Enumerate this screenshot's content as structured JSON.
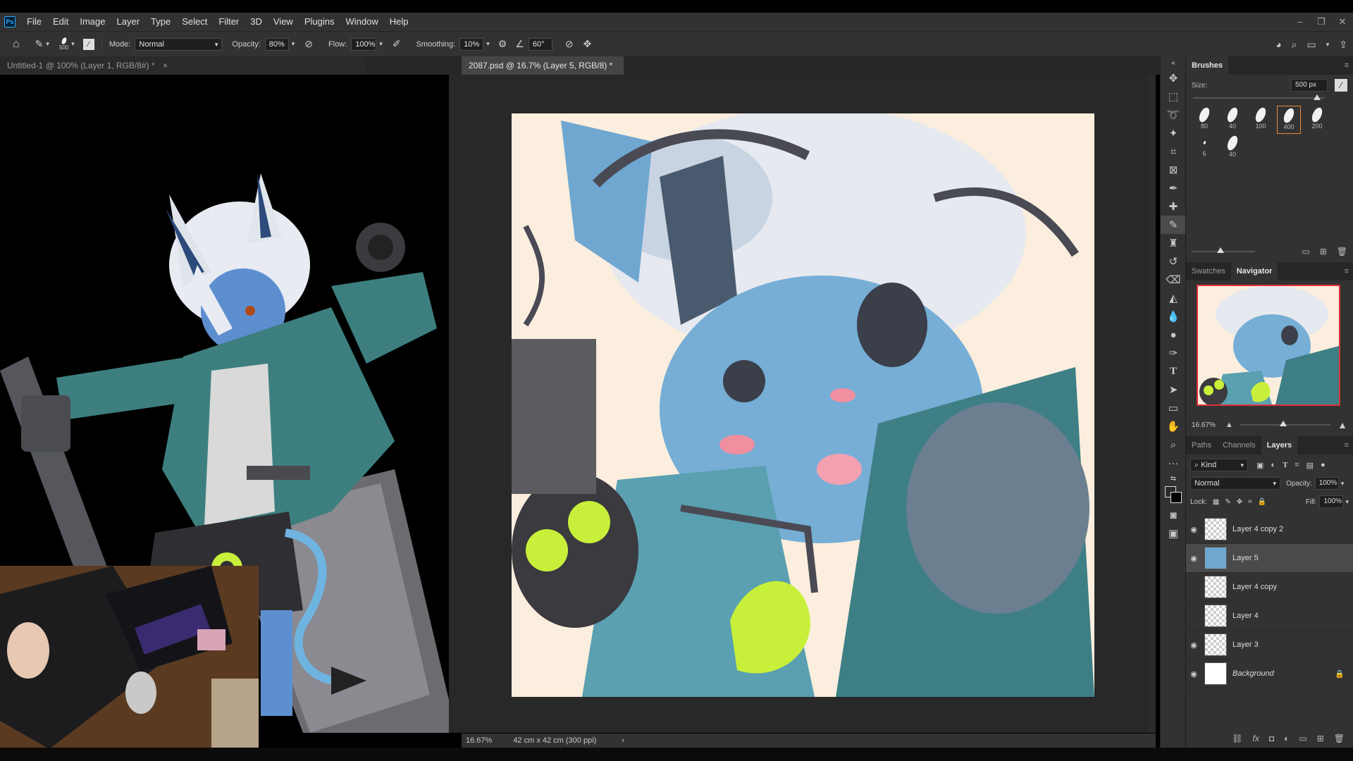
{
  "menu": {
    "logo": "Ps",
    "items": [
      "File",
      "Edit",
      "Image",
      "Layer",
      "Type",
      "Select",
      "Filter",
      "3D",
      "View",
      "Plugins",
      "Window",
      "Help"
    ]
  },
  "options": {
    "brush_size": "500",
    "mode_label": "Mode:",
    "mode_value": "Normal",
    "opacity_label": "Opacity:",
    "opacity_value": "80%",
    "flow_label": "Flow:",
    "flow_value": "100%",
    "smoothing_label": "Smoothing:",
    "smoothing_value": "10%",
    "angle_value": "60°"
  },
  "tabs": {
    "left": "Untitled-1 @ 100% (Layer 1, RGB/8#) *",
    "right": "2087.psd @ 16.7% (Layer 5, RGB/8) *"
  },
  "status": {
    "zoom": "16.67%",
    "doc_info": "42 cm x 42 cm (300 ppi)"
  },
  "brushes_panel": {
    "title": "Brushes",
    "size_label": "Size:",
    "size_value": "500 px",
    "tips": [
      "80",
      "40",
      "100",
      "400",
      "200",
      "6",
      "40"
    ],
    "selected_tip": "400"
  },
  "navigator_panel": {
    "tabs": [
      "Swatches",
      "Navigator"
    ],
    "zoom": "16.67%"
  },
  "layers_panel": {
    "tabs": [
      "Paths",
      "Channels",
      "Layers"
    ],
    "filter_kind": "Kind",
    "blend_mode": "Normal",
    "opacity_label": "Opacity:",
    "opacity_value": "100%",
    "lock_label": "Lock:",
    "fill_label": "Fill:",
    "fill_value": "100%",
    "layers": [
      {
        "name": "Layer 4 copy 2",
        "visible": true,
        "selected": false
      },
      {
        "name": "Layer 5",
        "visible": true,
        "selected": true
      },
      {
        "name": "Layer 4 copy",
        "visible": false,
        "selected": false
      },
      {
        "name": "Layer 4",
        "visible": false,
        "selected": false
      },
      {
        "name": "Layer 3",
        "visible": true,
        "selected": false
      },
      {
        "name": "Background",
        "visible": true,
        "selected": false
      }
    ]
  },
  "colors": {
    "accent": "#e98a3a",
    "canvas_bg": "#fbeede",
    "lime": "#c8f03a",
    "skin_blue": "#6fa7d0"
  }
}
